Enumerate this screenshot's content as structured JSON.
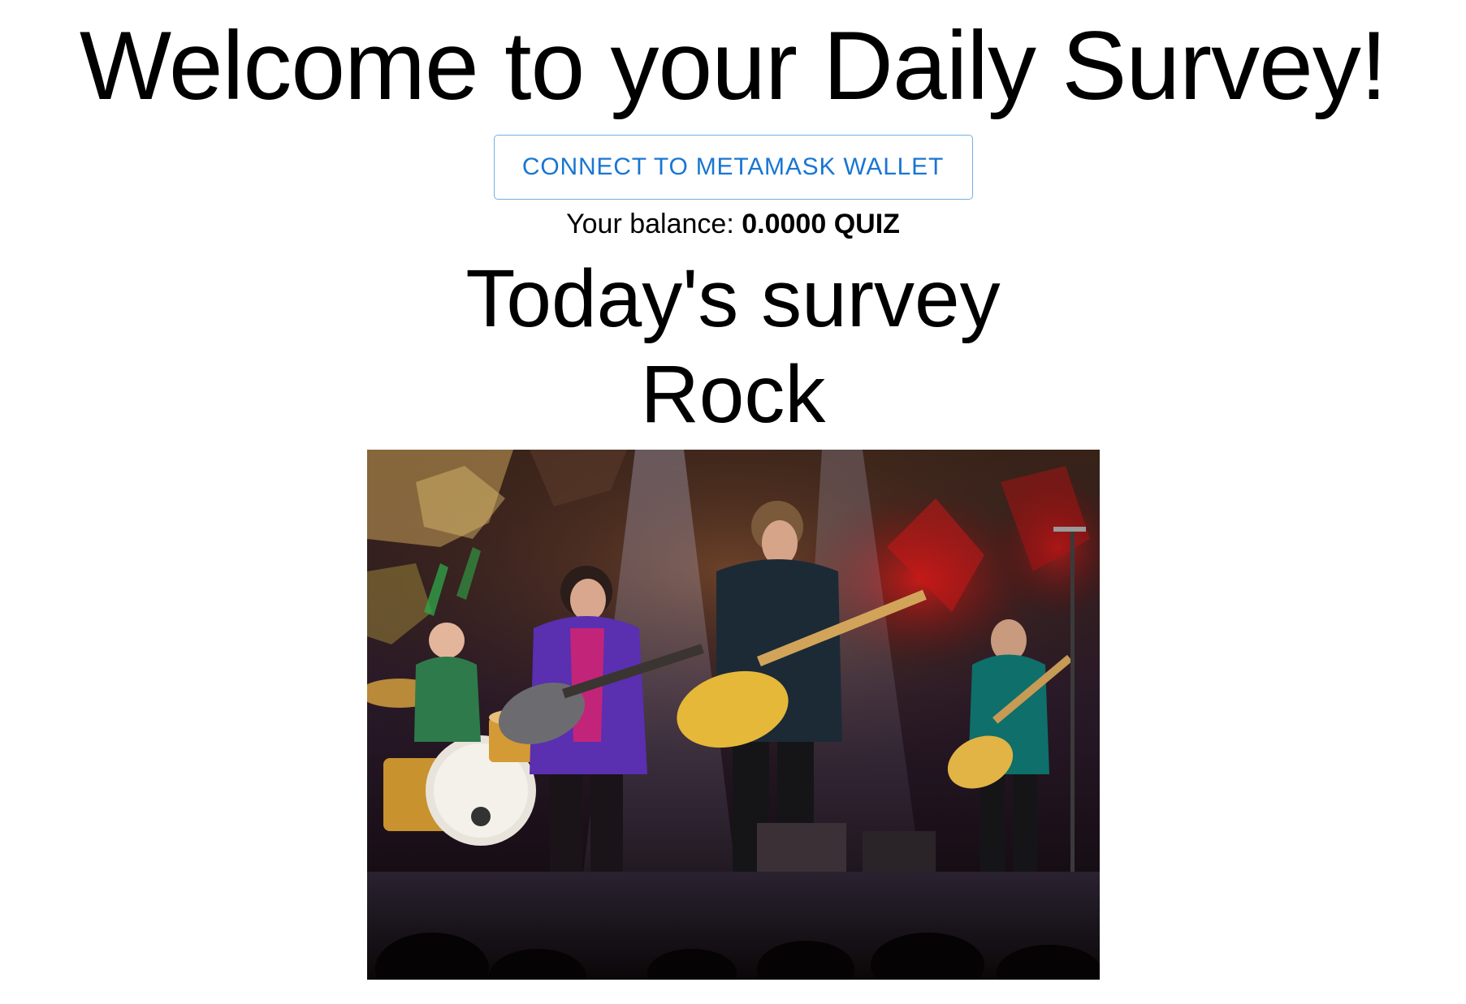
{
  "header": {
    "title": "Welcome to your Daily Survey!"
  },
  "wallet": {
    "connect_label": "CONNECT TO METAMASK WALLET",
    "balance_label": "Your balance:",
    "balance_value": "0.0000 QUIZ"
  },
  "survey": {
    "heading": "Today's survey",
    "topic": "Rock"
  },
  "colors": {
    "accent": "#1976d2",
    "text": "#000000",
    "background": "#ffffff"
  }
}
